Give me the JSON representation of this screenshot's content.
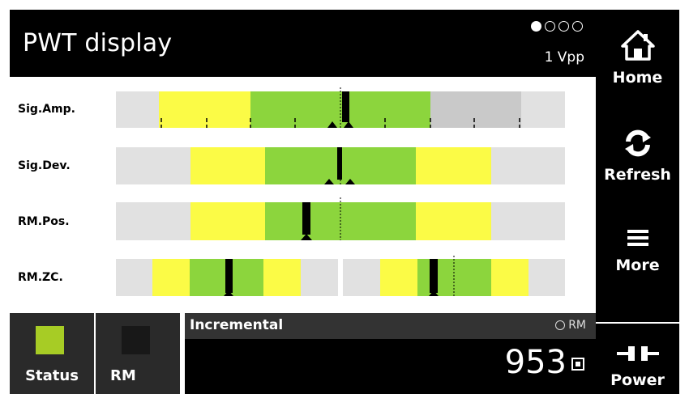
{
  "header": {
    "title": "PWT display",
    "unit": "1 Vpp",
    "pages": [
      true,
      false,
      false,
      false
    ]
  },
  "sidebar": {
    "home": {
      "label": "Home",
      "icon": "home-icon"
    },
    "refresh": {
      "label": "Refresh",
      "icon": "refresh-icon"
    },
    "more": {
      "label": "More",
      "icon": "hamburger-menu-icon"
    },
    "power": {
      "label": "Power",
      "icon": "power-plug-icon"
    }
  },
  "signals": {
    "labels": [
      "Sig.Amp.",
      "Sig.Dev.",
      "RM.Pos.",
      "RM.ZC."
    ]
  },
  "bottom": {
    "status": {
      "label": "Status",
      "color": "#a7cc25"
    },
    "rm": {
      "label": "RM"
    },
    "mode": "Incremental",
    "rm_indicator": "RM",
    "value": "953"
  },
  "colors": {
    "green": "#8cd53d",
    "yellow": "#fbfb46",
    "gray": "#e1e1e1",
    "dark_gray": "#c9c9c9",
    "black": "#000000"
  }
}
